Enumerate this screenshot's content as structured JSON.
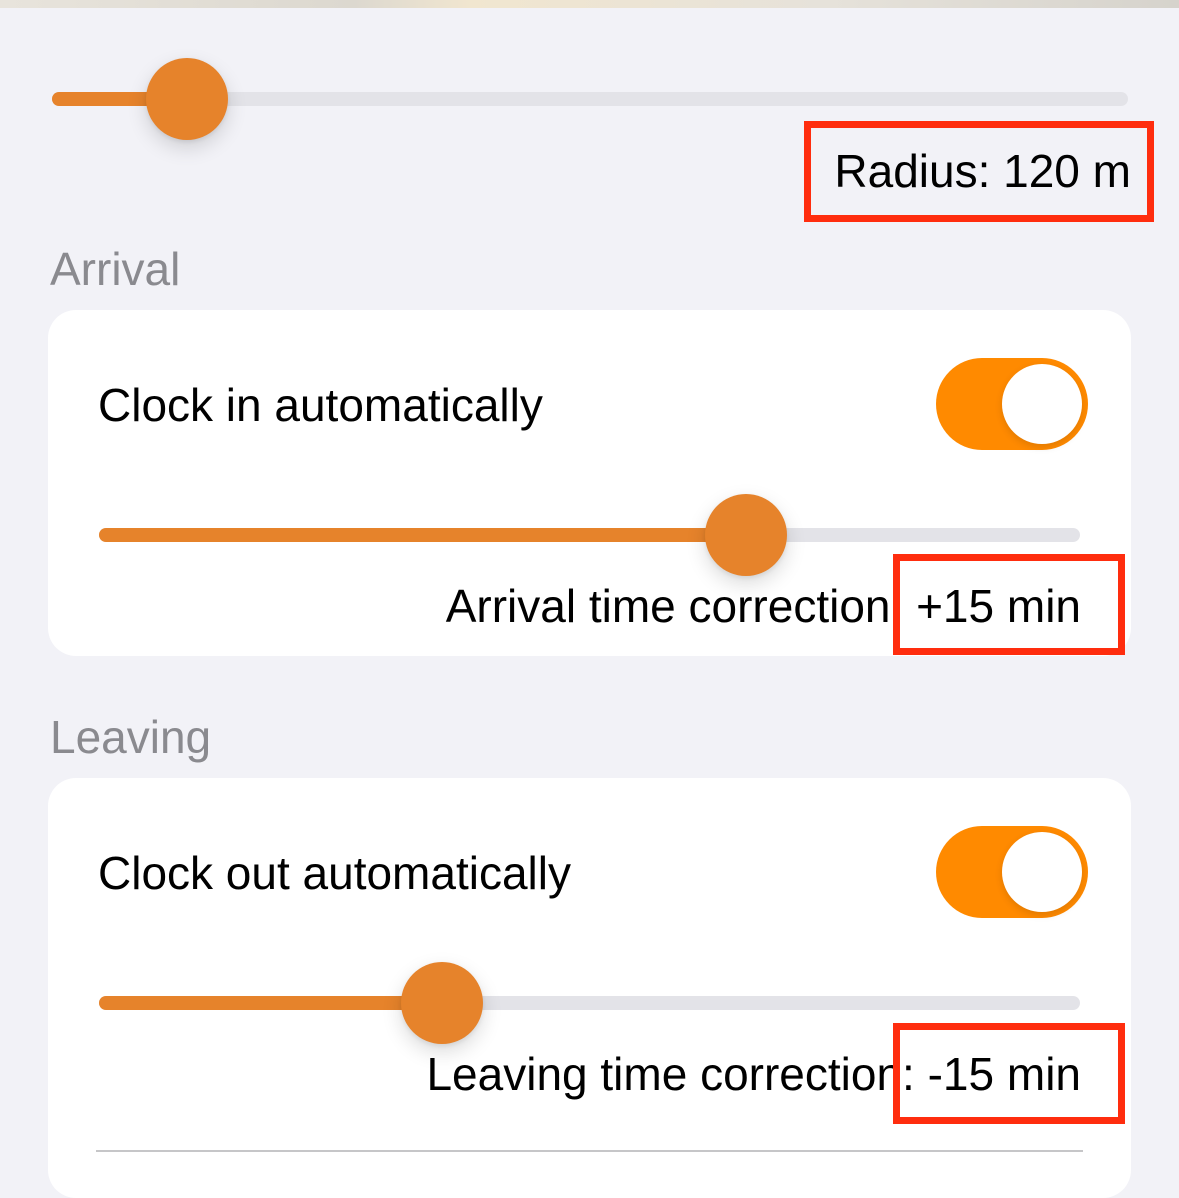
{
  "radius": {
    "label": "Radius: 120 m",
    "slider_fraction": 0.125
  },
  "arrival": {
    "section_title": "Arrival",
    "toggle_label": "Clock in automatically",
    "toggle_on": true,
    "correction_label": "Arrival time correction:",
    "correction_value": "+15 min",
    "slider_fraction": 0.66
  },
  "leaving": {
    "section_title": "Leaving",
    "toggle_label": "Clock out automatically",
    "toggle_on": true,
    "correction_label": "Leaving time correction:",
    "correction_value": "-15 min",
    "slider_fraction": 0.35
  },
  "colors": {
    "accent": "#e6832b",
    "toggle_on": "#ff8a00",
    "highlight": "#ff2d0e",
    "background": "#f2f2f7",
    "section_header": "#8a8a8f"
  }
}
